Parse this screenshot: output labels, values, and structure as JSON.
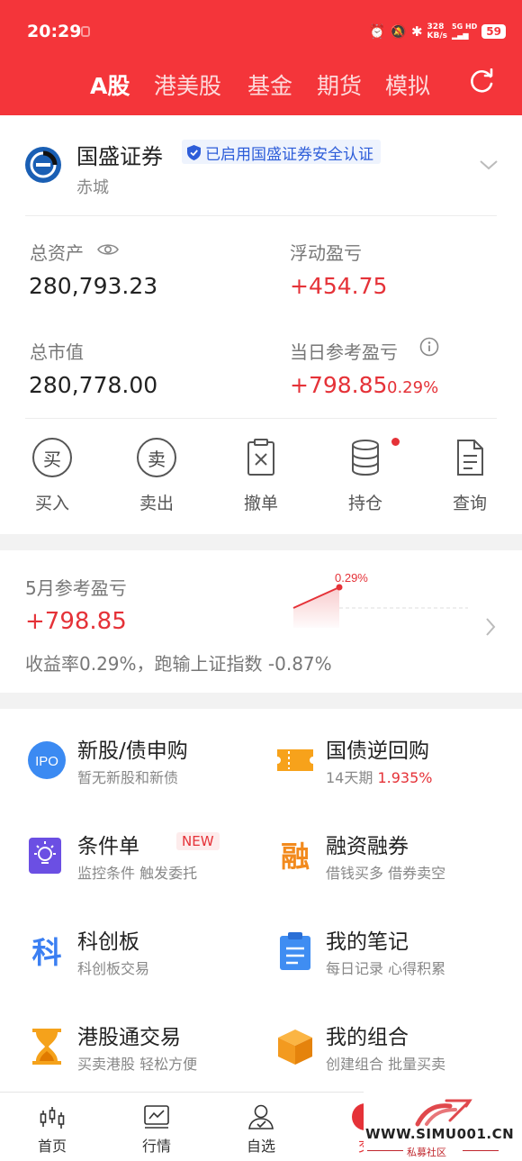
{
  "status_bar": {
    "time": "20:29",
    "net_speed": "328",
    "net_unit": "KB/s",
    "sig_top": "5G HD",
    "sig_bottom": "all",
    "battery": "59"
  },
  "header": {
    "tabs": [
      "A股",
      "港美股",
      "基金",
      "期货",
      "模拟"
    ],
    "active_tab": "A股"
  },
  "account": {
    "broker": "国盛证券",
    "security_badge": "已启用国盛证券安全认证",
    "name": "赤城",
    "total_assets_label": "总资产",
    "total_assets": "280,793.23",
    "floating_pl_label": "浮动盈亏",
    "floating_pl": "+454.75",
    "market_value_label": "总市值",
    "market_value": "280,778.00",
    "daily_pl_label": "当日参考盈亏",
    "daily_pl": "+798.85",
    "daily_pl_pct": "0.29%"
  },
  "actions": [
    {
      "label": "买入",
      "glyph": "买",
      "icon": "buy-icon"
    },
    {
      "label": "卖出",
      "glyph": "卖",
      "icon": "sell-icon"
    },
    {
      "label": "撤单",
      "icon": "cancel-order-icon"
    },
    {
      "label": "持仓",
      "icon": "holdings-icon"
    },
    {
      "label": "查询",
      "icon": "query-icon"
    }
  ],
  "monthly": {
    "label": "5月参考盈亏",
    "value": "+798.85",
    "summary": "收益率0.29%，跑输上证指数 -0.87%",
    "chart_point_label": "0.29%"
  },
  "services": [
    {
      "title": "新股/债申购",
      "sub": "暂无新股和新债",
      "icon": "ipo-icon",
      "icon_text": "IPO"
    },
    {
      "title": "国债逆回购",
      "sub_prefix": "14天期 ",
      "sub_rate": "1.935%",
      "icon": "ticket-icon"
    },
    {
      "title": "条件单",
      "tag": "NEW",
      "sub": "监控条件 触发委托",
      "icon": "condition-order-icon"
    },
    {
      "title": "融资融券",
      "sub": "借钱买多 借券卖空",
      "icon": "margin-icon",
      "icon_text": "融"
    },
    {
      "title": "科创板",
      "sub": "科创板交易",
      "icon": "star-market-icon",
      "icon_text": "科"
    },
    {
      "title": "我的笔记",
      "sub": "每日记录 心得积累",
      "icon": "notes-icon"
    },
    {
      "title": "港股通交易",
      "sub": "买卖港股 轻松方便",
      "icon": "hourglass-icon"
    },
    {
      "title": "我的组合",
      "sub": "创建组合 批量买卖",
      "icon": "portfolio-box-icon"
    }
  ],
  "bottom_nav": [
    {
      "label": "首页",
      "icon": "candlestick-icon"
    },
    {
      "label": "行情",
      "icon": "market-chart-icon"
    },
    {
      "label": "自选",
      "icon": "person-check-icon"
    },
    {
      "label": "交",
      "icon": "trade-icon"
    }
  ],
  "watermark": {
    "text": "WWW.SIMU001.CN",
    "sub": "私募社区"
  },
  "colors": {
    "brand_red": "#f4353a",
    "profit_red": "#e53238",
    "badge_blue": "#2d5dd9"
  }
}
